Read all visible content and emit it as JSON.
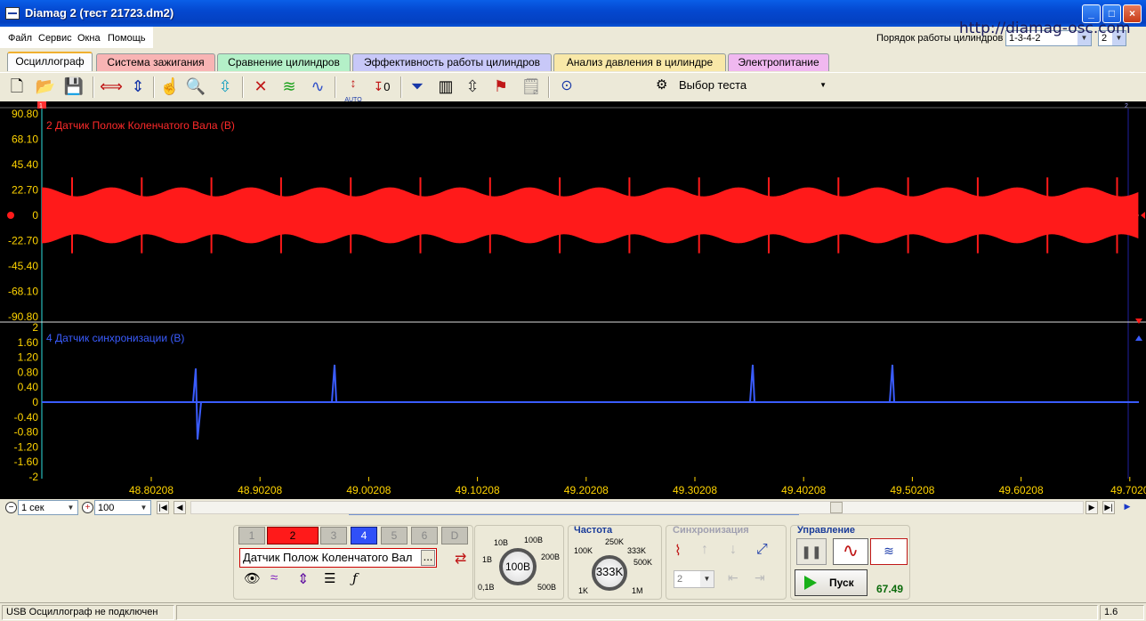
{
  "window": {
    "title": "Diamag 2 (тест 21723.dm2)",
    "minimize": "_",
    "maximize": "□",
    "close": "×"
  },
  "menu": [
    "Файл",
    "Сервис",
    "Окна",
    "Помощь"
  ],
  "watermark": "http://diamag-osc.com",
  "firing_order": {
    "label": "Порядок работы цилиндров",
    "value": "1-3-4-2",
    "cylinder": "2"
  },
  "tabs": [
    "Осциллограф",
    "Система зажигания",
    "Сравнение цилиндров",
    "Эффективность работы цилиндров",
    "Анализ давления в цилиндре",
    "Электропитание"
  ],
  "tab_colors": [
    "#fcfcfe",
    "#f8b4b4",
    "#b4f0c8",
    "#c8c8f8",
    "#f8e8a8",
    "#f0b8f0"
  ],
  "toolbar": {
    "icons": [
      "new-file-icon",
      "open-folder-icon",
      "save-icon",
      "horizontal-stretch-icon",
      "vertical-stretch-icon",
      "hand-pan-icon",
      "zoom-icon",
      "fit-icon",
      "cursor-cross-icon",
      "overlay-waves-icon",
      "compare-waves-icon",
      "auto-scale-icon",
      "zero-offset-icon",
      "filter-icon",
      "table-icon",
      "marker-icon",
      "flag-add-icon",
      "notes-icon",
      "auto-voltage-icon"
    ],
    "test_select": "Выбор теста",
    "auto_label": "AUTO",
    "zero_label": "0"
  },
  "channel_top": {
    "label": "2 Датчик Полож Коленчатого Вала (В)",
    "color": "#ff1a1a",
    "ticks": [
      "90.80",
      "68.10",
      "45.40",
      "22.70",
      "0",
      "-22.70",
      "-45.40",
      "-68.10",
      "-90.80"
    ]
  },
  "channel_bottom": {
    "label": "4 Датчик синхронизации (В)",
    "color": "#3a5cff",
    "ticks": [
      "2",
      "1.60",
      "1.20",
      "0.80",
      "0.40",
      "0",
      "-0.40",
      "-0.80",
      "-1.20",
      "-1.60",
      "-2"
    ]
  },
  "time_axis": {
    "ticks": [
      "48.80208",
      "48.90208",
      "49.00208",
      "49.10208",
      "49.20208",
      "49.30208",
      "49.40208",
      "49.50208",
      "49.60208",
      "49.7020"
    ]
  },
  "marker_labels": {
    "left": "1",
    "right": "2"
  },
  "scroll": {
    "time_per_div": "1 сек",
    "zoom": "100",
    "first": "|◀",
    "prev": "◀",
    "next": "▶",
    "last": "▶|",
    "play": "▶"
  },
  "channels": [
    "1",
    "2",
    "3",
    "4",
    "5",
    "6",
    "D"
  ],
  "sensor_name": "Датчик Полож Коленчатого Вал",
  "sensor_more": "...",
  "voltage_dial": {
    "value": "100В",
    "marks": [
      "10В",
      "100В",
      "1В",
      "200В",
      "0,1В",
      "500В"
    ]
  },
  "frequency": {
    "title": "Частота",
    "value": "333K",
    "marks": [
      "250K",
      "100K",
      "333K",
      "500K",
      "1K",
      "1M"
    ]
  },
  "sync": {
    "title": "Синхронизация",
    "value": "2"
  },
  "control": {
    "title": "Управление",
    "start": "Пуск",
    "counter": "67.49"
  },
  "status": {
    "message": "USB Осциллограф не подключен",
    "version": "1.6"
  }
}
